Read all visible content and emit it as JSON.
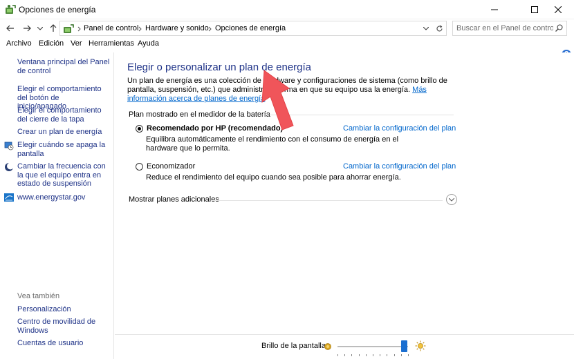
{
  "window": {
    "title": "Opciones de energía",
    "minimize_icon": "minimize-icon",
    "maximize_icon": "maximize-icon",
    "close_icon": "close-icon"
  },
  "address_bar": {
    "breadcrumbs": [
      "Panel de control",
      "Hardware y sonido",
      "Opciones de energía"
    ],
    "search_placeholder": "Buscar en el Panel de control"
  },
  "menu": [
    "Archivo",
    "Edición",
    "Ver",
    "Herramientas",
    "Ayuda"
  ],
  "help_label": "?",
  "sidebar": {
    "links": [
      "Ventana principal del Panel de control",
      "Elegir el comportamiento del botón de inicio/apagado",
      "Elegir el comportamiento del cierre de la tapa",
      "Crear un plan de energía",
      "Elegir cuándo se apaga la pantalla",
      "Cambiar la frecuencia con la que el equipo entra en estado de suspensión",
      "www.energystar.gov"
    ],
    "see_also_title": "Vea también",
    "see_also": [
      "Personalización",
      "Centro de movilidad de Windows",
      "Cuentas de usuario"
    ]
  },
  "main": {
    "title": "Elegir o personalizar un plan de energía",
    "description": "Un plan de energía es una colección de hardware y configuraciones de sistema (como brillo de pantalla, suspensión, etc.) que administra la forma en que su equipo usa la energía.",
    "more_info_link": "Más información acerca de planes de energía",
    "section_label": "Plan mostrado en el medidor de la batería",
    "plans": [
      {
        "name": "Recomendado por HP (recomendado)",
        "selected": true,
        "change_link": "Cambiar la configuración del plan",
        "description": "Equilibra automáticamente el rendimiento con el consumo de energía en el hardware que lo permita."
      },
      {
        "name": "Economizador",
        "selected": false,
        "change_link": "Cambiar la configuración del plan",
        "description": "Reduce el rendimiento del equipo cuando sea posible para ahorrar energía."
      }
    ],
    "more_plans": "Mostrar planes adicionales"
  },
  "bottom": {
    "brightness_label": "Brillo de la pantalla:",
    "brightness_level": 0.95
  },
  "colors": {
    "link": "#1e3287",
    "hyperlink": "#0066cc",
    "accent": "#1a6fd1",
    "annotation_arrow": "#f0555a"
  }
}
